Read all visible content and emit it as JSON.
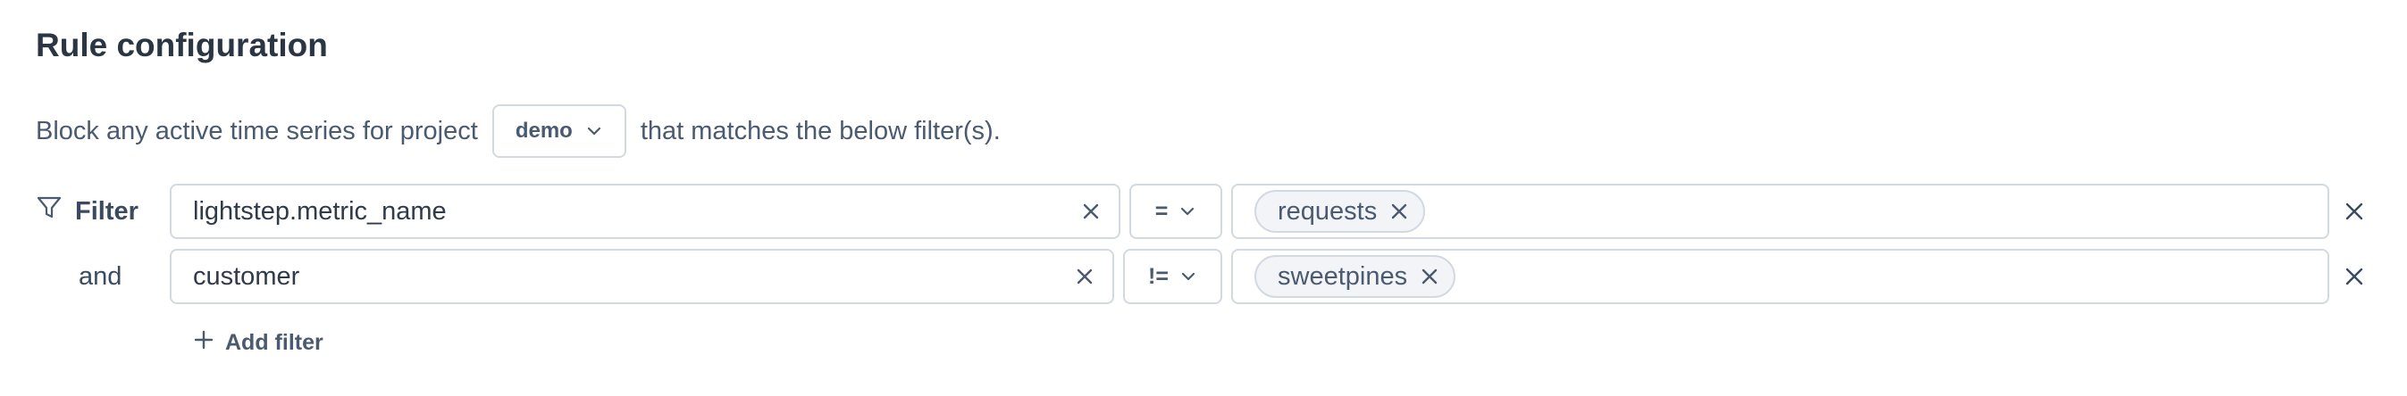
{
  "title": "Rule configuration",
  "sentence": {
    "prefix": "Block any active time series for project",
    "project": "demo",
    "suffix": "that matches the below filter(s)."
  },
  "filters": [
    {
      "label": "Filter",
      "key": "lightstep.metric_name",
      "operator": "=",
      "value": "requests"
    },
    {
      "label": "and",
      "key": "customer",
      "operator": "!=",
      "value": "sweetpines"
    }
  ],
  "add_filter_label": "Add filter",
  "icons": {
    "filter": "funnel-icon",
    "clear": "close-icon",
    "dropdown": "chevron-down-icon",
    "add": "plus-icon"
  },
  "colors": {
    "text": "#3b4a60",
    "border": "#d3d9e1",
    "chip_bg": "#f2f4f7"
  }
}
